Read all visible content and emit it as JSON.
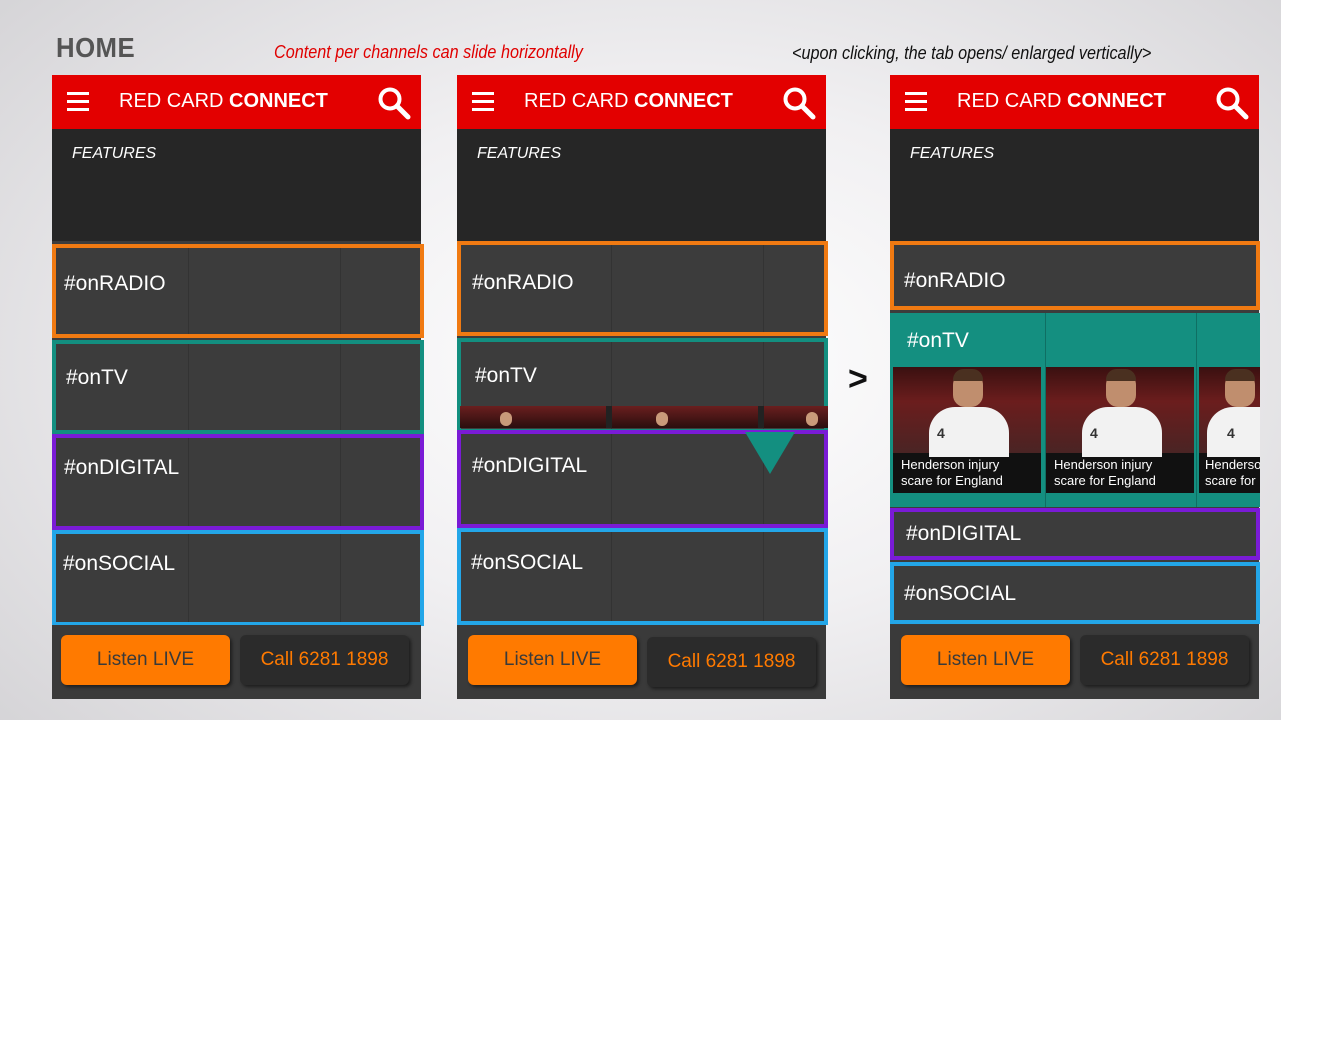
{
  "slide": {
    "title": "HOME",
    "note_slide": "Content per channels can slide horizontally",
    "note_click": "<upon clicking, the tab opens/ enlarged vertically>",
    "arrow": ">"
  },
  "app": {
    "brand_light": "RED CARD ",
    "brand_bold": "CONNECT",
    "features_label": "FEATURES",
    "channels": {
      "radio": "#onRADIO",
      "tv": "#onTV",
      "digital": "#onDIGITAL",
      "social": "#onSOCIAL"
    },
    "listen_button": "Listen LIVE",
    "call_button": "Call 6281 1898",
    "tv_cards": [
      {
        "line1": "Henderson injury",
        "line2": "scare for England"
      },
      {
        "line1": "Henderson injury",
        "line2": "scare for England"
      },
      {
        "line1": "Henderso",
        "line2": "scare for"
      }
    ]
  },
  "colors": {
    "header_red": "#e30000",
    "radio": "#f07a12",
    "tv": "#138f80",
    "digital": "#7a1bd6",
    "social": "#23a6e8",
    "accent_orange": "#ff7a00"
  },
  "icons": [
    "menu-icon",
    "search-icon"
  ]
}
